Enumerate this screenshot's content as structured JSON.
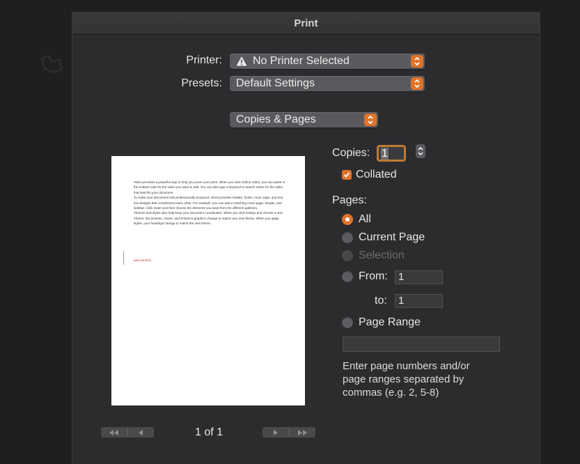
{
  "dialog": {
    "title": "Print"
  },
  "printer": {
    "label": "Printer:",
    "value": "No Printer Selected"
  },
  "presets": {
    "label": "Presets:",
    "value": "Default Settings"
  },
  "section_popup": {
    "value": "Copies & Pages"
  },
  "preview": {
    "paragraphs": [
      "Video provides a powerful way to help you prove your point. When you click Online Video, you can paste in the embed code for the video you want to add. You can also type a keyword to search online for the video that best fits your document.",
      "To make your document look professionally produced, Word provides header, footer, cover page, and text box designs that complement each other. For example, you can add a matching cover page, header, and sidebar. Click Insert and then choose the elements you want from the different galleries.",
      "Themes and styles also help keep your document coordinated. When you click Design and choose a new Theme, the pictures, charts, and SmartArt graphics change to match your new theme. When you apply styles, your headings change to match the new theme."
    ],
    "red_line": "aaa=rand(1)"
  },
  "copies": {
    "label": "Copies:",
    "value": "1",
    "collated_label": "Collated",
    "collated_checked": true
  },
  "pages": {
    "label": "Pages:",
    "all_label": "All",
    "current_label": "Current Page",
    "selection_label": "Selection",
    "from_label": "From:",
    "from_value": "1",
    "to_label": "to:",
    "to_value": "1",
    "range_label": "Page Range",
    "range_value": "",
    "help": "Enter page numbers and/or page ranges separated by commas (e.g. 2, 5-8)",
    "selected": "All"
  },
  "navigation": {
    "page_indicator": "1 of 1"
  },
  "colors": {
    "accent": "#e0732a",
    "sheet_bg": "#2c2c2e",
    "popup_bg": "#5a5a5e"
  }
}
